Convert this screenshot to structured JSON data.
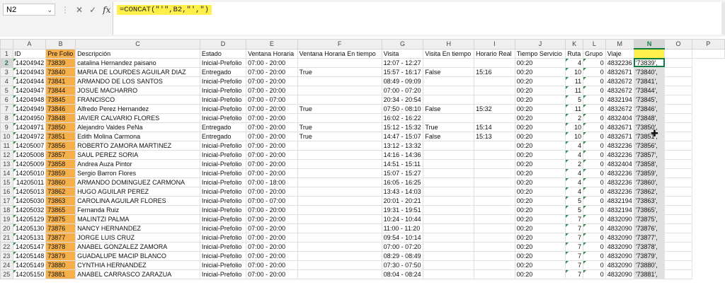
{
  "name_box": "N2",
  "formula": "=CONCAT(\"'\",B2,\"',\")",
  "columns": [
    "A",
    "B",
    "C",
    "D",
    "E",
    "F",
    "G",
    "H",
    "I",
    "J",
    "K",
    "L",
    "M",
    "N",
    "O",
    "P"
  ],
  "header_row": [
    "ID",
    "Pre Folio",
    "Descripción",
    "Estado",
    "Ventana Horaria",
    "Ventana Horaria En tiempo",
    "Visita",
    "Visita En tiempo",
    "Horario Real",
    "Tiempo Servicio",
    "Ruta",
    "Grupo",
    "Viaje",
    "",
    ""
  ],
  "rows": [
    {
      "n": "2",
      "a": "14204942",
      "b": "73839",
      "c": "catalina Hernandez paisano",
      "d": "Inicial-Prefolio",
      "e": "07:00 - 20:00",
      "f": "",
      "g": "12:07 - 12:27",
      "h": "",
      "i": "",
      "j": "00:20",
      "k": "4",
      "l": "0",
      "m": "4832236",
      "nv": "'73839',"
    },
    {
      "n": "3",
      "a": "14204943",
      "b": "73840",
      "c": "MARIA DE LOURDES AGUILAR DIAZ",
      "d": "Entregado",
      "e": "07:00 - 20:00",
      "f": "True",
      "g": "15:57 - 16:17",
      "h": "False",
      "i": "15:16",
      "j": "00:20",
      "k": "10",
      "l": "0",
      "m": "4832671",
      "nv": "'73840',"
    },
    {
      "n": "4",
      "a": "14204944",
      "b": "73841",
      "c": "ARMANDO DE LOS SANTOS",
      "d": "Inicial-Prefolio",
      "e": "07:00 - 20:00",
      "f": "",
      "g": "08:49 - 09:09",
      "h": "",
      "i": "",
      "j": "00:20",
      "k": "11",
      "l": "0",
      "m": "4832672",
      "nv": "'73841',"
    },
    {
      "n": "5",
      "a": "14204947",
      "b": "73844",
      "c": "JOSUE MACHARRO",
      "d": "Inicial-Prefolio",
      "e": "07:00 - 20:00",
      "f": "",
      "g": "07:00 - 07:20",
      "h": "",
      "i": "",
      "j": "00:20",
      "k": "11",
      "l": "0",
      "m": "4832672",
      "nv": "'73844',"
    },
    {
      "n": "6",
      "a": "14204948",
      "b": "73845",
      "c": "FRANCISCO",
      "d": "Inicial-Prefolio",
      "e": "07:00 - 07:00",
      "f": "",
      "g": "20:34 - 20:54",
      "h": "",
      "i": "",
      "j": "00:20",
      "k": "5",
      "l": "0",
      "m": "4832194",
      "nv": "'73845',"
    },
    {
      "n": "7",
      "a": "14204949",
      "b": "73846",
      "c": "Alfredo Perez Hernandez",
      "d": "Inicial-Prefolio",
      "e": "07:00 - 20:00",
      "f": "True",
      "g": "07:50 - 08:10",
      "h": "False",
      "i": "15:32",
      "j": "00:20",
      "k": "11",
      "l": "0",
      "m": "4832672",
      "nv": "'73846',"
    },
    {
      "n": "8",
      "a": "14204950",
      "b": "73848",
      "c": "JAVIER CALVARIO FLORES",
      "d": "Inicial-Prefolio",
      "e": "07:00 - 20:00",
      "f": "",
      "g": "16:02 - 16:22",
      "h": "",
      "i": "",
      "j": "00:20",
      "k": "2",
      "l": "0",
      "m": "4832404",
      "nv": "'73848',"
    },
    {
      "n": "9",
      "a": "14204971",
      "b": "73850",
      "c": "Alejandro Valdes PeNa",
      "d": "Entregado",
      "e": "07:00 - 20:00",
      "f": "True",
      "g": "15:12 - 15:32",
      "h": "True",
      "i": "15:14",
      "j": "00:20",
      "k": "10",
      "l": "0",
      "m": "4832671",
      "nv": "'73850',"
    },
    {
      "n": "10",
      "a": "14204972",
      "b": "73851",
      "c": "Edith Molina Carmona",
      "d": "Entregado",
      "e": "07:00 - 20:00",
      "f": "True",
      "g": "14:47 - 15:07",
      "h": "False",
      "i": "15:13",
      "j": "00:20",
      "k": "10",
      "l": "0",
      "m": "4832671",
      "nv": "'73851',"
    },
    {
      "n": "11",
      "a": "14205007",
      "b": "73856",
      "c": "ROBERTO ZAMORA MARTINEZ",
      "d": "Inicial-Prefolio",
      "e": "07:00 - 20:00",
      "f": "",
      "g": "13:12 - 13:32",
      "h": "",
      "i": "",
      "j": "00:20",
      "k": "4",
      "l": "0",
      "m": "4832236",
      "nv": "'73856',"
    },
    {
      "n": "12",
      "a": "14205008",
      "b": "73857",
      "c": "SAUL PEREZ SORIA",
      "d": "Inicial-Prefolio",
      "e": "07:00 - 20:00",
      "f": "",
      "g": "14:16 - 14:36",
      "h": "",
      "i": "",
      "j": "00:20",
      "k": "4",
      "l": "0",
      "m": "4832236",
      "nv": "'73857',"
    },
    {
      "n": "13",
      "a": "14205009",
      "b": "73858",
      "c": "Andrea Auza Pintor",
      "d": "Inicial-Prefolio",
      "e": "07:00 - 20:00",
      "f": "",
      "g": "14:51 - 15:11",
      "h": "",
      "i": "",
      "j": "00:20",
      "k": "2",
      "l": "0",
      "m": "4832404",
      "nv": "'73858',"
    },
    {
      "n": "14",
      "a": "14205010",
      "b": "73859",
      "c": "Sergio Barron Flores",
      "d": "Inicial-Prefolio",
      "e": "07:00 - 20:00",
      "f": "",
      "g": "15:07 - 15:27",
      "h": "",
      "i": "",
      "j": "00:20",
      "k": "4",
      "l": "0",
      "m": "4832236",
      "nv": "'73859',"
    },
    {
      "n": "15",
      "a": "14205011",
      "b": "73860",
      "c": "ARMANDO DOMINGUEZ CARMONA",
      "d": "Inicial-Prefolio",
      "e": "07:00 - 18:00",
      "f": "",
      "g": "16:05 - 16:25",
      "h": "",
      "i": "",
      "j": "00:20",
      "k": "4",
      "l": "0",
      "m": "4832236",
      "nv": "'73860',"
    },
    {
      "n": "16",
      "a": "14205013",
      "b": "73862",
      "c": "HUGO AGUILAR PEREZ",
      "d": "Inicial-Prefolio",
      "e": "07:00 - 20:00",
      "f": "",
      "g": "13:43 - 14:03",
      "h": "",
      "i": "",
      "j": "00:20",
      "k": "4",
      "l": "0",
      "m": "4832236",
      "nv": "'73862',"
    },
    {
      "n": "17",
      "a": "14205030",
      "b": "73863",
      "c": "CAROLINA AGUILAR FLORES",
      "d": "Inicial-Prefolio",
      "e": "07:00 - 07:00",
      "f": "",
      "g": "20:01 - 20:21",
      "h": "",
      "i": "",
      "j": "00:20",
      "k": "5",
      "l": "0",
      "m": "4832194",
      "nv": "'73863',"
    },
    {
      "n": "18",
      "a": "14205032",
      "b": "73865",
      "c": "Fernanda Ruiz",
      "d": "Inicial-Prefolio",
      "e": "07:00 - 20:00",
      "f": "",
      "g": "19:31 - 19:51",
      "h": "",
      "i": "",
      "j": "00:20",
      "k": "5",
      "l": "0",
      "m": "4832194",
      "nv": "'73865',"
    },
    {
      "n": "19",
      "a": "14205129",
      "b": "73875",
      "c": "MALINTZI PALMA",
      "d": "Inicial-Prefolio",
      "e": "07:00 - 20:00",
      "f": "",
      "g": "10:24 - 10:44",
      "h": "",
      "i": "",
      "j": "00:20",
      "k": "7",
      "l": "0",
      "m": "4832090",
      "nv": "'73875',"
    },
    {
      "n": "20",
      "a": "14205130",
      "b": "73876",
      "c": "NANCY HERNANDEZ",
      "d": "Inicial-Prefolio",
      "e": "07:00 - 20:00",
      "f": "",
      "g": "11:00 - 11:20",
      "h": "",
      "i": "",
      "j": "00:20",
      "k": "7",
      "l": "0",
      "m": "4832090",
      "nv": "'73876',"
    },
    {
      "n": "21",
      "a": "14205131",
      "b": "73877",
      "c": "JORGE LUIS CRUZ",
      "d": "Inicial-Prefolio",
      "e": "07:00 - 20:00",
      "f": "",
      "g": "09:54 - 10:14",
      "h": "",
      "i": "",
      "j": "00:20",
      "k": "7",
      "l": "0",
      "m": "4832090",
      "nv": "'73877',"
    },
    {
      "n": "22",
      "a": "14205147",
      "b": "73878",
      "c": "ANABEL GONZALEZ ZAMORA",
      "d": "Inicial-Prefolio",
      "e": "07:00 - 20:00",
      "f": "",
      "g": "07:00 - 07:20",
      "h": "",
      "i": "",
      "j": "00:20",
      "k": "7",
      "l": "0",
      "m": "4832090",
      "nv": "'73878',"
    },
    {
      "n": "23",
      "a": "14205148",
      "b": "73879",
      "c": "GUADALUPE MACIP BLANCO",
      "d": "Inicial-Prefolio",
      "e": "07:00 - 20:00",
      "f": "",
      "g": "08:29 - 08:49",
      "h": "",
      "i": "",
      "j": "00:20",
      "k": "7",
      "l": "0",
      "m": "4832090",
      "nv": "'73879',"
    },
    {
      "n": "24",
      "a": "14205149",
      "b": "73880",
      "c": "CYNTHIA HERNANDEZ",
      "d": "Inicial-Prefolio",
      "e": "07:00 - 20:00",
      "f": "",
      "g": "07:30 - 07:50",
      "h": "",
      "i": "",
      "j": "00:20",
      "k": "7",
      "l": "0",
      "m": "4832090",
      "nv": "'73880',"
    },
    {
      "n": "25",
      "a": "14205150",
      "b": "73881",
      "c": "ANABEL CARRASCO ZARAZUA",
      "d": "Inicial-Prefolio",
      "e": "07:00 - 20:00",
      "f": "",
      "g": "08:04 - 08:24",
      "h": "",
      "i": "",
      "j": "00:20",
      "k": "7",
      "l": "0",
      "m": "4832090",
      "nv": "'73881',"
    }
  ],
  "colors": {
    "excel_green": "#107c41",
    "prefolio_orange": "#f5b04c",
    "highlight_yellow": "#ffef4a"
  },
  "icons": [
    "dropdown-chevron-icon",
    "cancel-x-icon",
    "confirm-check-icon",
    "fx-function-icon",
    "cell-cursor-icon"
  ]
}
